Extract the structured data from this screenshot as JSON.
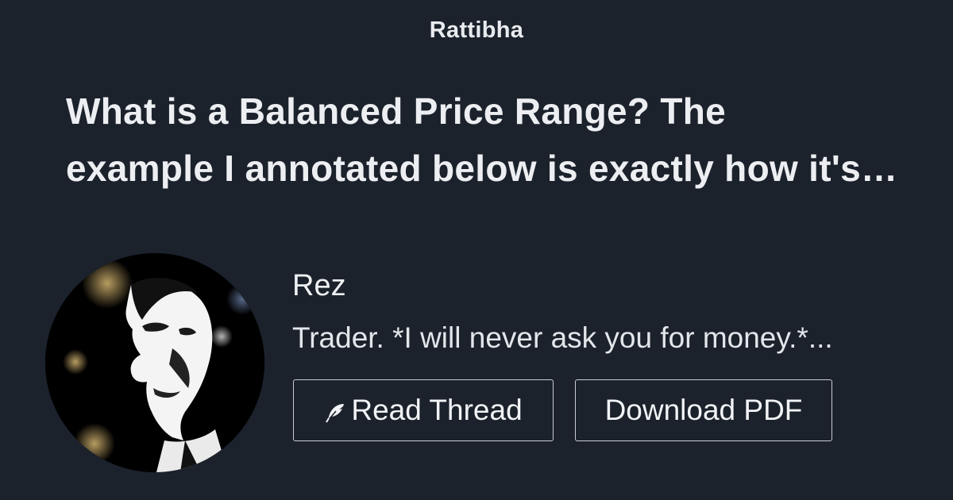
{
  "site": {
    "brand": "Rattibha"
  },
  "thread": {
    "title_line_1": "What is a Balanced Price Range? The",
    "title_line_2": "example I annotated below is exactly how it's…"
  },
  "author": {
    "name": "Rez",
    "bio": "Trader. *I will never ask you for money.*..."
  },
  "actions": {
    "read_label": "Read Thread",
    "read_icon": "feather-icon",
    "pdf_label": "Download PDF"
  },
  "colors": {
    "background": "#1b222c",
    "text": "#eef0f2",
    "button_border": "#c9ccd1"
  }
}
